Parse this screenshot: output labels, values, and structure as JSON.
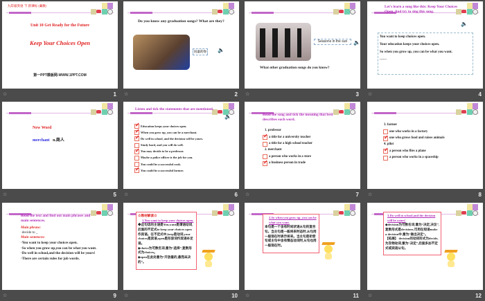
{
  "slides": [
    {
      "number": "1",
      "header": "九年级英语·下    新课标 [冀教]",
      "unit": "Unit 10  Get Ready for the Future",
      "title": "Keep Your Choices Open",
      "footer_site": "第一PPT模板网-WWW.1PPT.COM"
    },
    {
      "number": "2",
      "question": "Do you know any graduation songs? What are they?",
      "song_label": "同桌的你"
    },
    {
      "number": "3",
      "song_label": "Seasons in the sun",
      "question": "What other graduation songs do you know?"
    },
    {
      "number": "4",
      "instruction": "Let's learn a song like this: Keep Your Choices Open. And try to sing this song.",
      "lines": [
        "You want to keep choices open.",
        "Your education keeps your choices open.",
        "So when you grow up, you can be what you want.",
        "……"
      ]
    },
    {
      "number": "5",
      "heading": "New Word",
      "word": "merchant",
      "meaning": "n.商人"
    },
    {
      "number": "6",
      "instruction": "Listen and tick the statements that are mentioned.",
      "items": [
        {
          "text": "Education keeps your choices open.",
          "checked": true
        },
        {
          "text": "When you grow up, you can be a merchant.",
          "checked": true
        },
        {
          "text": "Do well in school, and the decision will be yours.",
          "checked": true
        },
        {
          "text": "Study hard, and you will do well.",
          "checked": false
        },
        {
          "text": "You may decide to be a professor.",
          "checked": true
        },
        {
          "text": "Maybe a police officer is the job for you.",
          "checked": false
        },
        {
          "text": "You could be a successful cook.",
          "checked": false
        },
        {
          "text": "You could be a successful farmer.",
          "checked": true
        }
      ]
    },
    {
      "number": "7",
      "instruction": "Read the song and tick the meaning that best describes each word.",
      "groups": [
        {
          "word": "1.  professor",
          "options": [
            {
              "text": "a title for a university teacher",
              "checked": true
            },
            {
              "text": "a title for a high school teacher",
              "checked": false
            }
          ]
        },
        {
          "word": "2.  merchant",
          "options": [
            {
              "text": "a person who works in a store",
              "checked": false
            },
            {
              "text": "a business person in trade",
              "checked": true
            }
          ]
        }
      ]
    },
    {
      "number": "8",
      "groups": [
        {
          "word": "3. farmer",
          "options": [
            {
              "text": "one who works in a factory",
              "checked": false
            },
            {
              "text": "one who grows food and raises animals",
              "checked": true
            }
          ]
        },
        {
          "word": "4. pilot",
          "options": [
            {
              "text": "a person who flies a plane",
              "checked": true
            },
            {
              "text": "a person who works in a spaceship",
              "checked": false
            }
          ]
        }
      ]
    },
    {
      "number": "9",
      "instruction": "Read the text and find out main phrases and main sentences.",
      "phrase_label": "Main phrase:",
      "phrase": "·decide to _",
      "sentences_label": "Main sentences:",
      "sentences": [
        "·You want to keep your choices open.",
        "·So when you grow up,you can be what you want.",
        "·Do well in school,and the decision will be yours!",
        "·There are certain rules for job words."
      ]
    },
    {
      "number": "10",
      "box_title": "☆教材解读☆",
      "heading": "1.You want to keep your choices open.",
      "paras": [
        "◆这句话的主语是You,want是谓语动词,后面的不定式to keep your choices open作宾语。在不定式中,keep是动词,your choices是宾语,open是形容词作宾语补足语。",
        "◆choice为可数名词,意为“选择”,复数形式为choices。",
        "◆open在此处意为“开放着的,悬而未决的”。"
      ]
    },
    {
      "number": "11",
      "heading": "2.So when you grow up, you can be what you want.",
      "paras": [
        "本句是一个含有时间状语从句的复合句。当主句是一般将来时态时,从句用一般现在时表示将来。当主句是祈使句或主句中含有情态动词时,从句也用一般现在时。"
      ]
    },
    {
      "number": "12",
      "heading": "3.Do well in school,and the decision will be yours!",
      "paras": [
        "◆decision为可数名词,意为“决定,决议”,复数形式是decisions,可用在短语make a decision中,意为“做出决定”。",
        "【拓展】 decision的动词形式为decide,为及物动词,意为“决定”,后面多加不定式或宾语从句。"
      ]
    }
  ]
}
